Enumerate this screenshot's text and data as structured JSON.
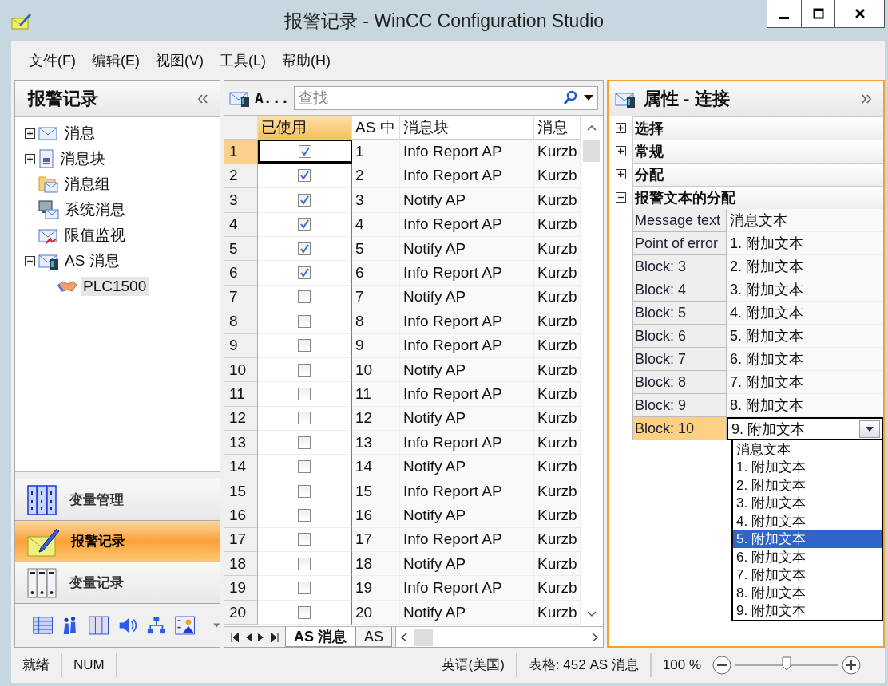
{
  "window": {
    "title": "报警记录 - WinCC Configuration Studio"
  },
  "menu": [
    "文件(F)",
    "编辑(E)",
    "视图(V)",
    "工具(L)",
    "帮助(H)"
  ],
  "navigator": {
    "title": "报警记录",
    "tree": [
      {
        "label": "消息",
        "kind": "envelope",
        "expanded": false,
        "selected": false
      },
      {
        "label": "消息块",
        "kind": "block",
        "expanded": false,
        "selected": false
      },
      {
        "label": "消息组",
        "kind": "folder",
        "selected": false
      },
      {
        "label": "系统消息",
        "kind": "system",
        "selected": false
      },
      {
        "label": "限值监视",
        "kind": "limit",
        "selected": false
      },
      {
        "label": "AS 消息",
        "kind": "as",
        "expanded": true,
        "selected": false,
        "children": [
          {
            "label": "PLC1500",
            "kind": "plc",
            "selected": true
          }
        ]
      }
    ],
    "editors": [
      {
        "label": "变量管理",
        "kind": "tags",
        "selected": false
      },
      {
        "label": "报警记录",
        "kind": "alarm",
        "selected": true
      },
      {
        "label": "变量记录",
        "kind": "logging",
        "selected": false
      }
    ]
  },
  "table": {
    "title": "A...",
    "search": {
      "placeholder": "查找"
    },
    "columns": [
      "已使用",
      "AS 中",
      "消息块",
      "消息"
    ],
    "rows": [
      {
        "row": "1",
        "used": true,
        "as_no": "1",
        "block": "Info Report AP",
        "column_4": "Kurzb",
        "selected": true
      },
      {
        "row": "2",
        "used": true,
        "as_no": "2",
        "block": "Info Report AP",
        "column_4": "Kurzb",
        "selected": false
      },
      {
        "row": "3",
        "used": true,
        "as_no": "3",
        "block": "Notify AP",
        "column_4": "Kurzb",
        "selected": false
      },
      {
        "row": "4",
        "used": true,
        "as_no": "4",
        "block": "Info Report AP",
        "column_4": "Kurzb",
        "selected": false
      },
      {
        "row": "5",
        "used": true,
        "as_no": "5",
        "block": "Notify AP",
        "column_4": "Kurzb",
        "selected": false
      },
      {
        "row": "6",
        "used": true,
        "as_no": "6",
        "block": "Info Report AP",
        "column_4": "Kurzb",
        "selected": false
      },
      {
        "row": "7",
        "used": false,
        "as_no": "7",
        "block": "Notify AP",
        "column_4": "Kurzb",
        "selected": false
      },
      {
        "row": "8",
        "used": false,
        "as_no": "8",
        "block": "Info Report AP",
        "column_4": "Kurzb",
        "selected": false
      },
      {
        "row": "9",
        "used": false,
        "as_no": "9",
        "block": "Info Report AP",
        "column_4": "Kurzb",
        "selected": false
      },
      {
        "row": "10",
        "used": false,
        "as_no": "10",
        "block": "Notify AP",
        "column_4": "Kurzb",
        "selected": false
      },
      {
        "row": "11",
        "used": false,
        "as_no": "11",
        "block": "Info Report AP",
        "column_4": "Kurzb",
        "selected": false
      },
      {
        "row": "12",
        "used": false,
        "as_no": "12",
        "block": "Notify AP",
        "column_4": "Kurzb",
        "selected": false
      },
      {
        "row": "13",
        "used": false,
        "as_no": "13",
        "block": "Info Report AP",
        "column_4": "Kurzb",
        "selected": false
      },
      {
        "row": "14",
        "used": false,
        "as_no": "14",
        "block": "Notify AP",
        "column_4": "Kurzb",
        "selected": false
      },
      {
        "row": "15",
        "used": false,
        "as_no": "15",
        "block": "Info Report AP",
        "column_4": "Kurzb",
        "selected": false
      },
      {
        "row": "16",
        "used": false,
        "as_no": "16",
        "block": "Notify AP",
        "column_4": "Kurzb",
        "selected": false
      },
      {
        "row": "17",
        "used": false,
        "as_no": "17",
        "block": "Info Report AP",
        "column_4": "Kurzb",
        "selected": false
      },
      {
        "row": "18",
        "used": false,
        "as_no": "18",
        "block": "Notify AP",
        "column_4": "Kurzb",
        "selected": false
      },
      {
        "row": "19",
        "used": false,
        "as_no": "19",
        "block": "Info Report AP",
        "column_4": "Kurzb",
        "selected": false
      },
      {
        "row": "20",
        "used": false,
        "as_no": "20",
        "block": "Notify AP",
        "column_4": "Kurzb",
        "selected": false
      }
    ],
    "sheets": [
      {
        "label": "AS 消息",
        "selected": true
      },
      {
        "label": "AS",
        "selected": false
      }
    ]
  },
  "properties": {
    "title": "属性 - 连接",
    "groups": [
      {
        "label": "选择",
        "expanded": false
      },
      {
        "label": "常规",
        "expanded": false
      },
      {
        "label": "分配",
        "expanded": false
      },
      {
        "label": "报警文本的分配",
        "expanded": true
      }
    ],
    "rows": [
      {
        "name": "Message text",
        "value": "消息文本",
        "selected": false
      },
      {
        "name": "Point of error",
        "value": "1. 附加文本",
        "selected": false
      },
      {
        "name": "Block:  3",
        "value": "2. 附加文本",
        "selected": false
      },
      {
        "name": "Block:  4",
        "value": "3. 附加文本",
        "selected": false
      },
      {
        "name": "Block:  5",
        "value": "4. 附加文本",
        "selected": false
      },
      {
        "name": "Block:  6",
        "value": "5. 附加文本",
        "selected": false
      },
      {
        "name": "Block:  7",
        "value": "6. 附加文本",
        "selected": false
      },
      {
        "name": "Block:  8",
        "value": "7. 附加文本",
        "selected": false
      },
      {
        "name": "Block:  9",
        "value": "8. 附加文本",
        "selected": false
      },
      {
        "name": "Block: 10",
        "value": "9. 附加文本",
        "selected": true
      }
    ],
    "dropdown": [
      {
        "label": "消息文本",
        "selected": false
      },
      {
        "label": "1. 附加文本",
        "selected": false
      },
      {
        "label": "2. 附加文本",
        "selected": false
      },
      {
        "label": "3. 附加文本",
        "selected": false
      },
      {
        "label": "4. 附加文本",
        "selected": false
      },
      {
        "label": "5. 附加文本",
        "selected": true
      },
      {
        "label": "6. 附加文本",
        "selected": false
      },
      {
        "label": "7. 附加文本",
        "selected": false
      },
      {
        "label": "8. 附加文本",
        "selected": false
      },
      {
        "label": "9. 附加文本",
        "selected": false
      }
    ]
  },
  "status_bar": {
    "state": "就绪",
    "num": "NUM",
    "language": "英语(美国)",
    "table_info": "表格: 452 AS 消息",
    "zoom": "100 %",
    "zoom_slider": {
      "level": 0.5
    }
  }
}
